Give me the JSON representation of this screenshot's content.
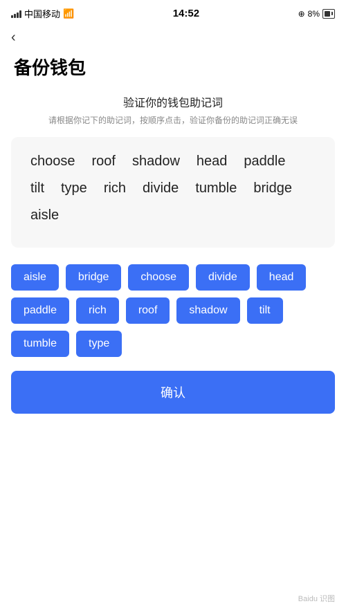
{
  "statusBar": {
    "carrier": "中国移动",
    "time": "14:52",
    "battery": "8%"
  },
  "back": {
    "label": "‹"
  },
  "page": {
    "title": "备份钱包",
    "sectionTitle": "验证你的钱包助记词",
    "sectionDesc": "请根据你记下的助记词，按顺序点击，验证你备份的助记词正确无误"
  },
  "displayedWords": [
    "choose",
    "roof",
    "shadow",
    "head",
    "paddle",
    "tilt",
    "type",
    "rich",
    "divide",
    "tumble",
    "bridge",
    "aisle"
  ],
  "tagWords": [
    "aisle",
    "bridge",
    "choose",
    "divide",
    "head",
    "paddle",
    "rich",
    "roof",
    "shadow",
    "tilt",
    "tumble",
    "type"
  ],
  "confirmButton": {
    "label": "确认"
  }
}
